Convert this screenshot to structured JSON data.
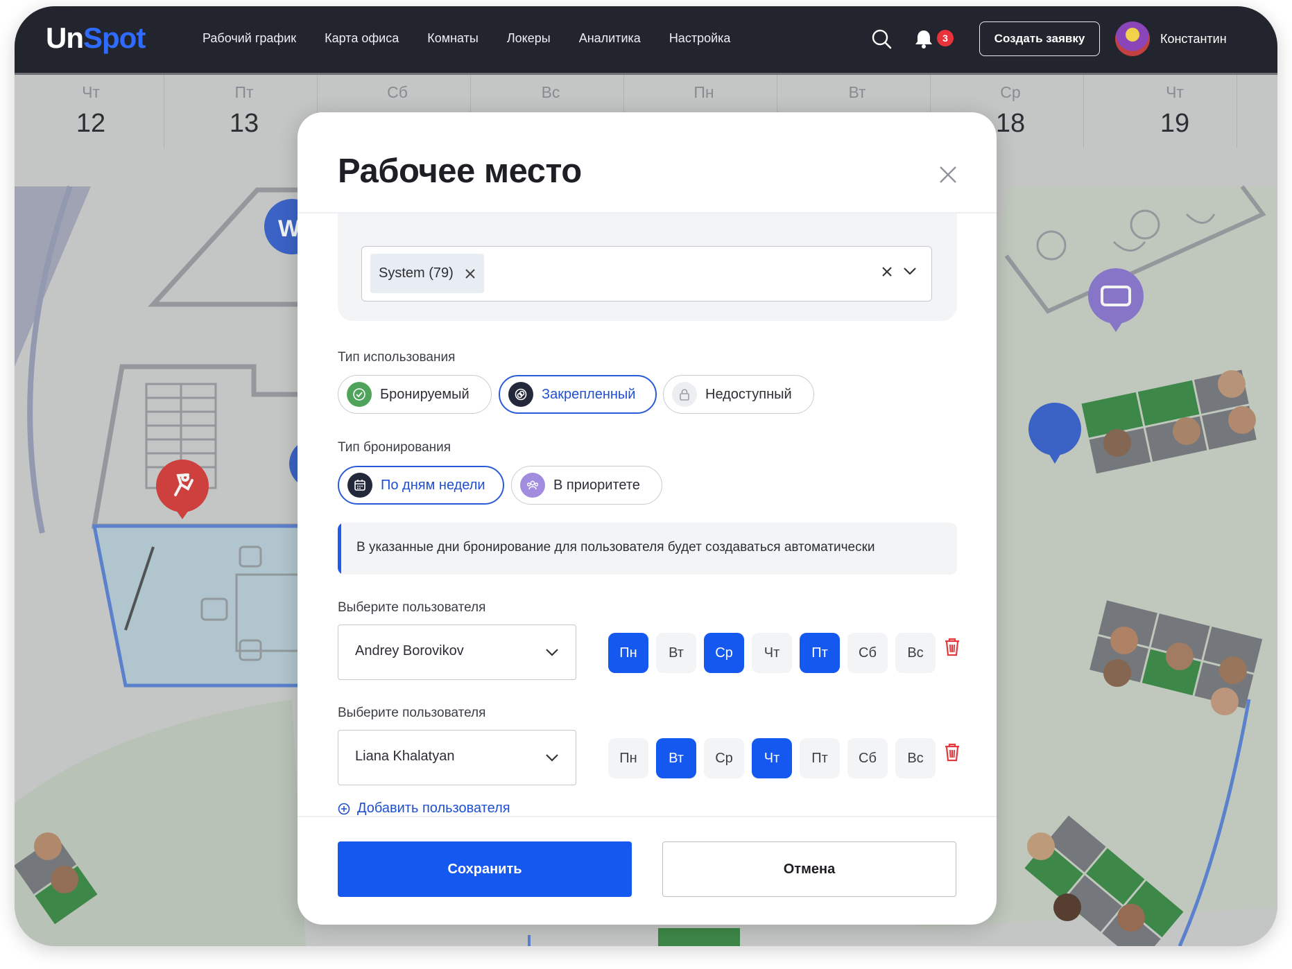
{
  "app": {
    "logo_un": "Un",
    "logo_spot": "Spot"
  },
  "nav": [
    {
      "label": "Рабочий график"
    },
    {
      "label": "Карта офиса"
    },
    {
      "label": "Комнаты"
    },
    {
      "label": "Локеры"
    },
    {
      "label": "Аналитика"
    },
    {
      "label": "Настройка"
    }
  ],
  "header": {
    "notifications_count": "3",
    "create_request_label": "Создать заявку",
    "user_name": "Константин"
  },
  "calendar": {
    "days": [
      {
        "name": "Чт",
        "date": "12"
      },
      {
        "name": "Пт",
        "date": "13"
      },
      {
        "name": "Сб",
        "date": ""
      },
      {
        "name": "Вс",
        "date": ""
      },
      {
        "name": "Пн",
        "date": ""
      },
      {
        "name": "Вт",
        "date": ""
      },
      {
        "name": "Ср",
        "date": "18"
      },
      {
        "name": "Чт",
        "date": "19"
      }
    ]
  },
  "map": {
    "marker_letter": "W"
  },
  "modal": {
    "title": "Рабочее место",
    "group_chip": "System (79)",
    "usage_type": {
      "label": "Тип использования",
      "options": [
        "Бронируемый",
        "Закрепленный",
        "Недоступный"
      ],
      "selected": "Закрепленный"
    },
    "booking_type": {
      "label": "Тип бронирования",
      "options": [
        "По дням недели",
        "В приоритете"
      ],
      "selected": "По дням недели"
    },
    "info_text": "В указанные дни бронирование для пользователя будет создаваться автоматически",
    "assignments": [
      {
        "label": "Выберите пользователя",
        "user": "Andrey Borovikov",
        "days": [
          {
            "d": "Пн",
            "on": true
          },
          {
            "d": "Вт",
            "on": false
          },
          {
            "d": "Ср",
            "on": true
          },
          {
            "d": "Чт",
            "on": false
          },
          {
            "d": "Пт",
            "on": true
          },
          {
            "d": "Сб",
            "on": false
          },
          {
            "d": "Вс",
            "on": false
          }
        ]
      },
      {
        "label": "Выберите пользователя",
        "user": "Liana Khalatyan",
        "days": [
          {
            "d": "Пн",
            "on": false
          },
          {
            "d": "Вт",
            "on": true
          },
          {
            "d": "Ср",
            "on": false
          },
          {
            "d": "Чт",
            "on": true
          },
          {
            "d": "Пт",
            "on": false
          },
          {
            "d": "Сб",
            "on": false
          },
          {
            "d": "Вс",
            "on": false
          }
        ]
      }
    ],
    "add_user_label": "Добавить пользователя",
    "save_label": "Сохранить",
    "cancel_label": "Отмена"
  },
  "colors": {
    "accent": "#1458ef",
    "topbar": "#22252d",
    "desk_green": "#3f8d4a",
    "danger": "#e8323c"
  }
}
